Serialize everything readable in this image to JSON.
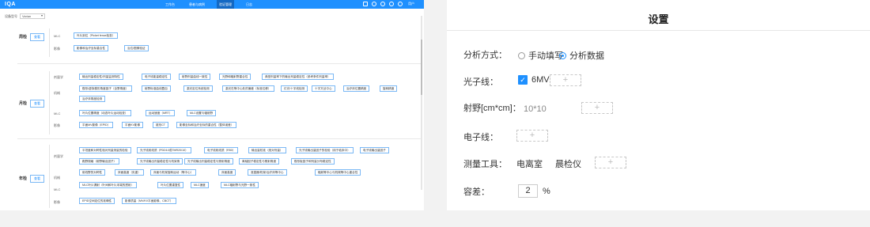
{
  "left": {
    "logo": "IQA",
    "nav": [
      "工作台",
      "患者与病例",
      "验证管理",
      "日志"
    ],
    "user": "用户",
    "filter_label": "设备型号",
    "filter_value": "Varian",
    "sections": {
      "s1": {
        "label": "周检",
        "button": "查看",
        "rows": [
          "MLC",
          "影像"
        ]
      },
      "s2": {
        "label": "月检",
        "button": "查看",
        "rows": [
          "剂量学",
          "机械",
          "MLC",
          "影像"
        ]
      },
      "s3": {
        "label": "年检",
        "button": "查看",
        "rows": [
          "剂量学",
          "机械",
          "MLC",
          "影像"
        ]
      }
    },
    "tags": {
      "w_mlc": [
        "叶片到位（Picket fence检查）"
      ],
      "w_img": [
        "影像和治疗坐标重合性",
        "治位/图像验证"
      ],
      "m_dose_1": [
        "输出剂量稳定性/剂量监测特性",
        "电子线能量稳定性",
        "射野剂量曲线一致性",
        "光野和辐射野重合性",
        "典型剂量率下的输出剂量稳定性（参考条件剂量率）"
      ],
      "m_mech_1": [
        "楔形/虚拟楔形角度因子（全野角度）",
        "射野标准曲线叠加",
        "激光定位系统检测",
        "激光在等中心处的偏差（标准位移）",
        "灯光/十字线检测",
        "十字叉丝中心",
        "治疗床位置精度",
        "旋转精度"
      ],
      "m_mech_2": [
        "治疗床角度检测"
      ],
      "m_mlc": [
        "叶片位置精度（动态叶片运动检查）",
        "运动速度（MRT）",
        "MLC设置与辐射野"
      ],
      "m_img": [
        "平面MV影像（EPID）",
        "平面KV影像",
        "锥形CT",
        "影像坐标和治疗坐标的重合性（整体误差）"
      ],
      "y_dose_1": [
        "平坦度和对称性相对剂量测量的检验",
        "光子线射线质（PDD10或TMR20/10）",
        "电子线射线质（R50）",
        "输出量校准（绝对剂量）",
        "光子线输出量因子的检验（用于临床中）",
        "电子线输出量因子"
      ],
      "y_dose_2": [
        "跑野规格（射野输出因子）",
        "光子线输出剂量稳定性与机架角",
        "光子线输出剂量稳定性与照射角度",
        "离轴因子稳定性与照射角度",
        "楔形板因子和剂量分布稳定性"
      ],
      "y_mech_1": [
        "射线野的对称性",
        "床面高度（负重）",
        "床面与机架旋转运动（等中心）",
        "床面高度",
        "准直器/机架/治疗床等中心",
        "辐射等中心与机械等中心重合性"
      ],
      "y_mlc": [
        "MLC叶片漏射（叶间和叶片末端的透射）",
        "叶片位置重复性",
        "MLC速度",
        "MLC辐射野与光野一致性"
      ],
      "y_img": [
        "EPID空间定位的准确性",
        "影像质量（MV/KV平面影像、CBCT）"
      ]
    }
  },
  "right": {
    "title": "设置",
    "analysis_label": "分析方式：",
    "radio_manual": "手动填写",
    "radio_data": "分析数据",
    "photon_label": "光子线：",
    "photon_value": "6MV",
    "field_label": "射野[cm*cm]：",
    "field_value": "10*10",
    "electron_label": "电子线：",
    "tool_label": "测量工具：",
    "tool_1": "电离室",
    "tool_2": "晨检仪",
    "tol_label": "容差：",
    "tol_value": "2",
    "tol_unit": "%",
    "plus": "+"
  },
  "colors": {
    "accent": "#1e90ff"
  }
}
